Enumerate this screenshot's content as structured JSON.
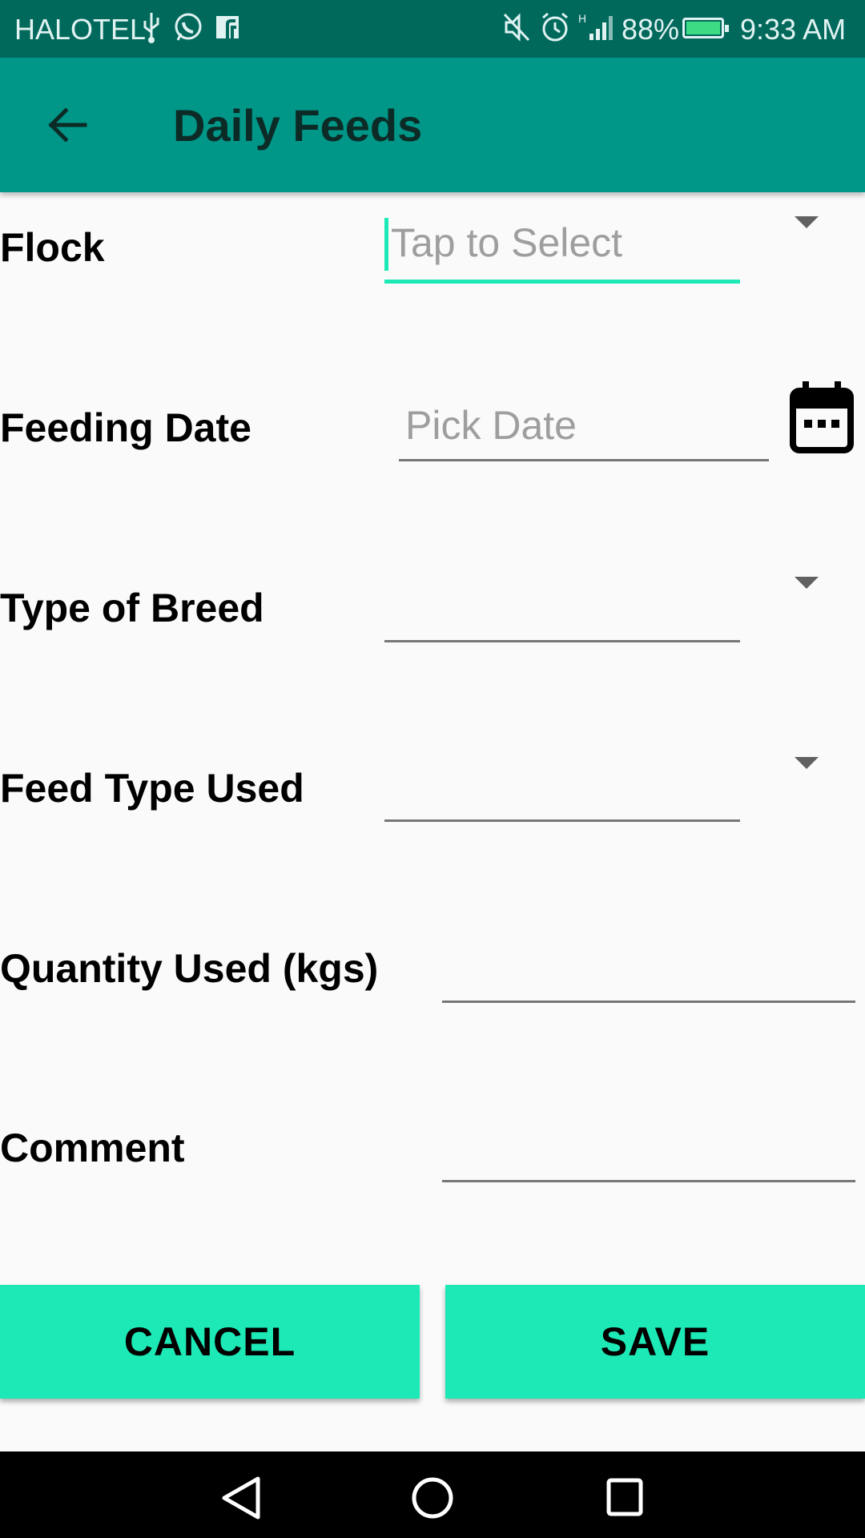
{
  "status_bar": {
    "carrier": "HALOTEL",
    "battery": "88%",
    "time": "9:33 AM"
  },
  "app_bar": {
    "title": "Daily Feeds"
  },
  "form": {
    "flock": {
      "label": "Flock",
      "placeholder": "Tap to Select"
    },
    "feeding_date": {
      "label": "Feeding Date",
      "placeholder": "Pick Date"
    },
    "breed": {
      "label": "Type of Breed",
      "value": ""
    },
    "feed_type": {
      "label": "Feed Type Used",
      "value": ""
    },
    "quantity": {
      "label": "Quantity Used (kgs)",
      "value": ""
    },
    "comment": {
      "label": "Comment",
      "value": ""
    }
  },
  "buttons": {
    "cancel": "CANCEL",
    "save": "SAVE"
  },
  "colors": {
    "status_bar": "#00695c",
    "app_bar": "#009688",
    "accent": "#1de9b6"
  }
}
